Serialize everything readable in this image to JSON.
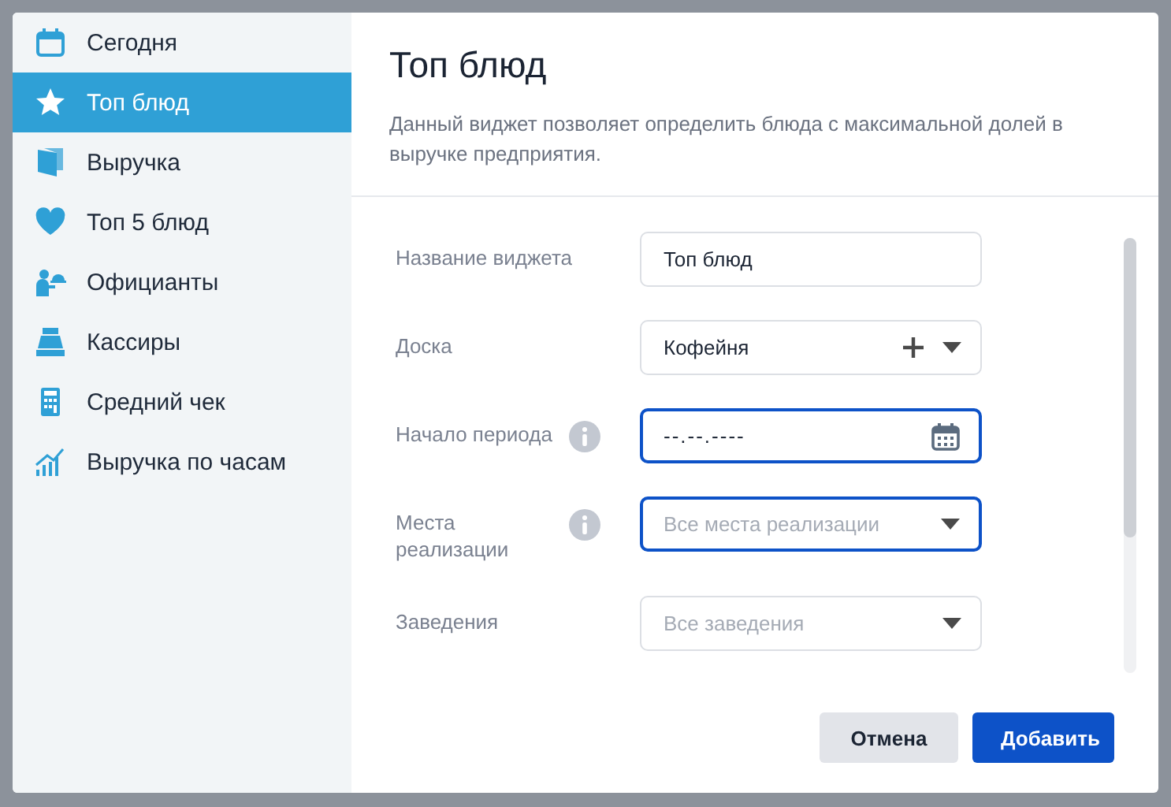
{
  "sidebar": {
    "items": [
      {
        "label": "Сегодня",
        "selected": false
      },
      {
        "label": "Топ блюд",
        "selected": true
      },
      {
        "label": "Выручка",
        "selected": false
      },
      {
        "label": "Топ 5 блюд",
        "selected": false
      },
      {
        "label": "Официанты",
        "selected": false
      },
      {
        "label": "Кассиры",
        "selected": false
      },
      {
        "label": "Средний чек",
        "selected": false
      },
      {
        "label": "Выручка по часам",
        "selected": false
      }
    ]
  },
  "dialog": {
    "title": "Топ блюд",
    "description": "Данный виджет позволяет определить блюда с максимальной долей в выручке предприятия."
  },
  "form": {
    "fields": [
      {
        "label": "Название виджета",
        "kind": "text",
        "value": "Топ блюд",
        "info": false,
        "focused": false
      },
      {
        "label": "Доска",
        "kind": "select-add",
        "value": "Кофейня",
        "info": false,
        "focused": false
      },
      {
        "label": "Начало периода",
        "kind": "date",
        "value": "--.--.----",
        "info": true,
        "focused": true
      },
      {
        "label": "Места реализации",
        "kind": "select",
        "placeholder": "Все места реализации",
        "info": true,
        "focused": true
      },
      {
        "label": "Заведения",
        "kind": "select",
        "placeholder": "Все заведения",
        "info": false,
        "focused": false
      }
    ]
  },
  "buttons": [
    {
      "label": "Отмена",
      "kind": "secondary"
    },
    {
      "label": "Добавить",
      "kind": "primary"
    }
  ]
}
